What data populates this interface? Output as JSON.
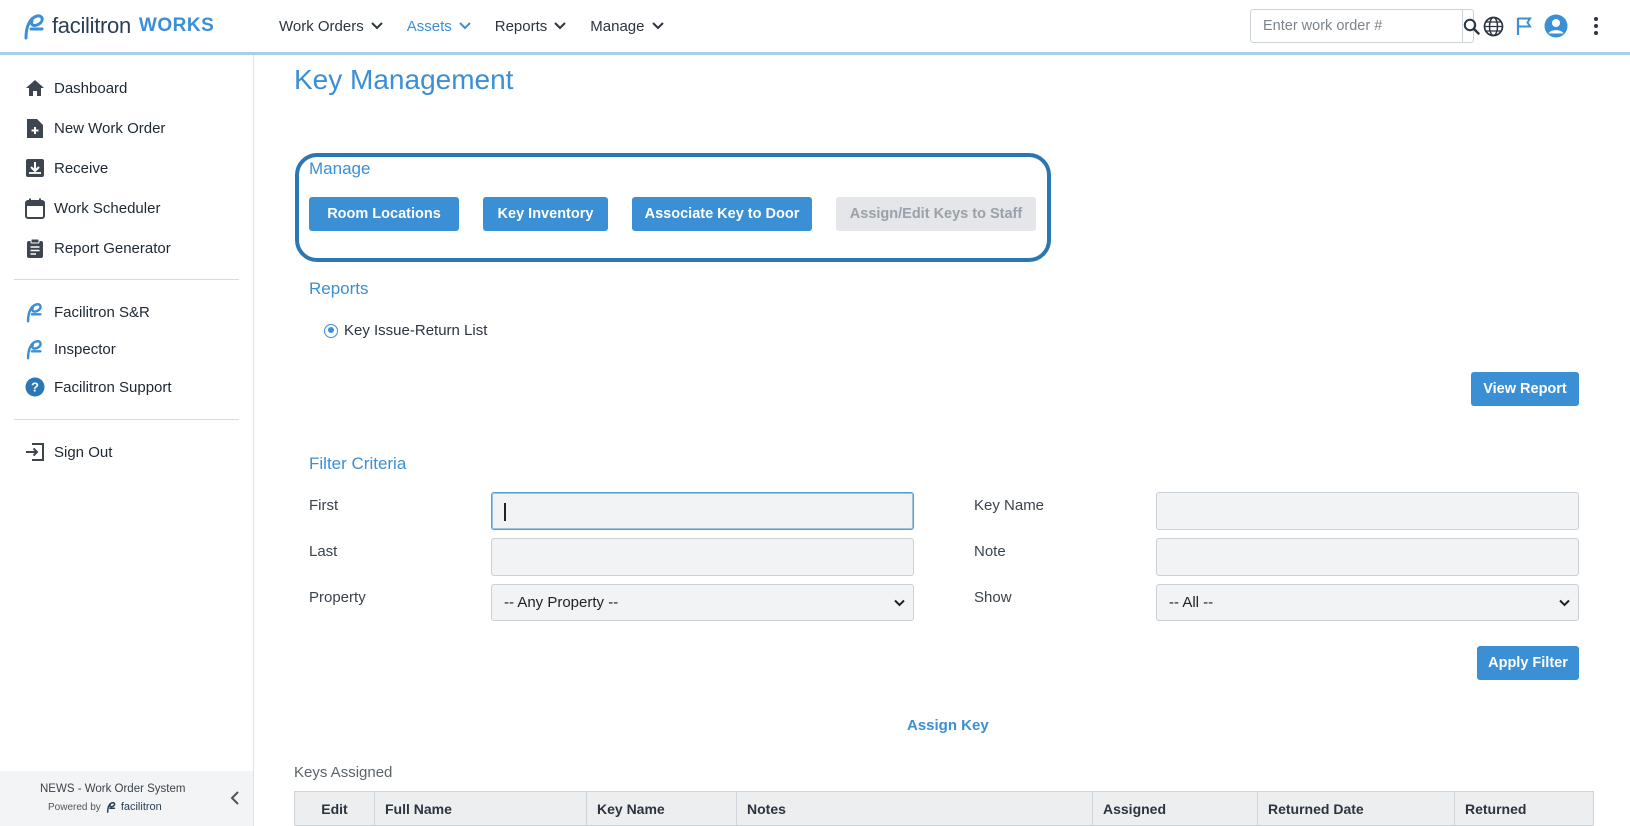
{
  "app": {
    "logo_text": "facilitron",
    "logo_suffix": "WORKS"
  },
  "nav": {
    "items": [
      {
        "label": "Work Orders",
        "active": false
      },
      {
        "label": "Assets",
        "active": true
      },
      {
        "label": "Reports",
        "active": false
      },
      {
        "label": "Manage",
        "active": false
      }
    ],
    "search_placeholder": "Enter work order #",
    "icons": [
      "search-icon",
      "globe-icon",
      "flag-icon",
      "user-avatar-icon",
      "more-vertical-icon"
    ]
  },
  "sidebar": {
    "items": [
      {
        "label": "Dashboard",
        "icon": "home-icon"
      },
      {
        "label": "New Work Order",
        "icon": "new-document-icon"
      },
      {
        "label": "Receive",
        "icon": "inbox-download-icon"
      },
      {
        "label": "Work Scheduler",
        "icon": "calendar-icon"
      },
      {
        "label": "Report Generator",
        "icon": "clipboard-icon"
      },
      {
        "label": "Facilitron S&R",
        "icon": "facilitron-logo-icon"
      },
      {
        "label": "Inspector",
        "icon": "facilitron-logo-icon"
      },
      {
        "label": "Facilitron Support",
        "icon": "help-circle-icon"
      },
      {
        "label": "Sign Out",
        "icon": "sign-out-icon"
      }
    ],
    "footer_line1": "NEWS - Work Order System",
    "footer_powered": "Powered by",
    "footer_brand": "facilitron"
  },
  "page": {
    "title": "Key Management",
    "manage": {
      "heading": "Manage",
      "buttons": [
        {
          "label": "Room Locations",
          "disabled": false
        },
        {
          "label": "Key Inventory",
          "disabled": false
        },
        {
          "label": "Associate Key to Door",
          "disabled": false
        },
        {
          "label": "Assign/Edit Keys to Staff",
          "disabled": true
        }
      ]
    },
    "reports": {
      "heading": "Reports",
      "option_label": "Key Issue-Return List",
      "option_selected": true,
      "view_button": "View Report"
    },
    "filter": {
      "heading": "Filter Criteria",
      "first_label": "First",
      "first_value": "",
      "last_label": "Last",
      "last_value": "",
      "property_label": "Property",
      "property_value": "-- Any Property --",
      "key_name_label": "Key Name",
      "key_name_value": "",
      "note_label": "Note",
      "note_value": "",
      "show_label": "Show",
      "show_value": "-- All --",
      "apply_button": "Apply Filter"
    },
    "assign_key_link": "Assign Key",
    "table": {
      "caption": "Keys Assigned",
      "columns": [
        "Edit",
        "Full Name",
        "Key Name",
        "Notes",
        "Assigned",
        "Returned Date",
        "Returned"
      ]
    }
  },
  "colors": {
    "accent": "#3b8fd4",
    "highlight_border": "#2a77b4",
    "disabled_bg": "#e4e6e9"
  }
}
